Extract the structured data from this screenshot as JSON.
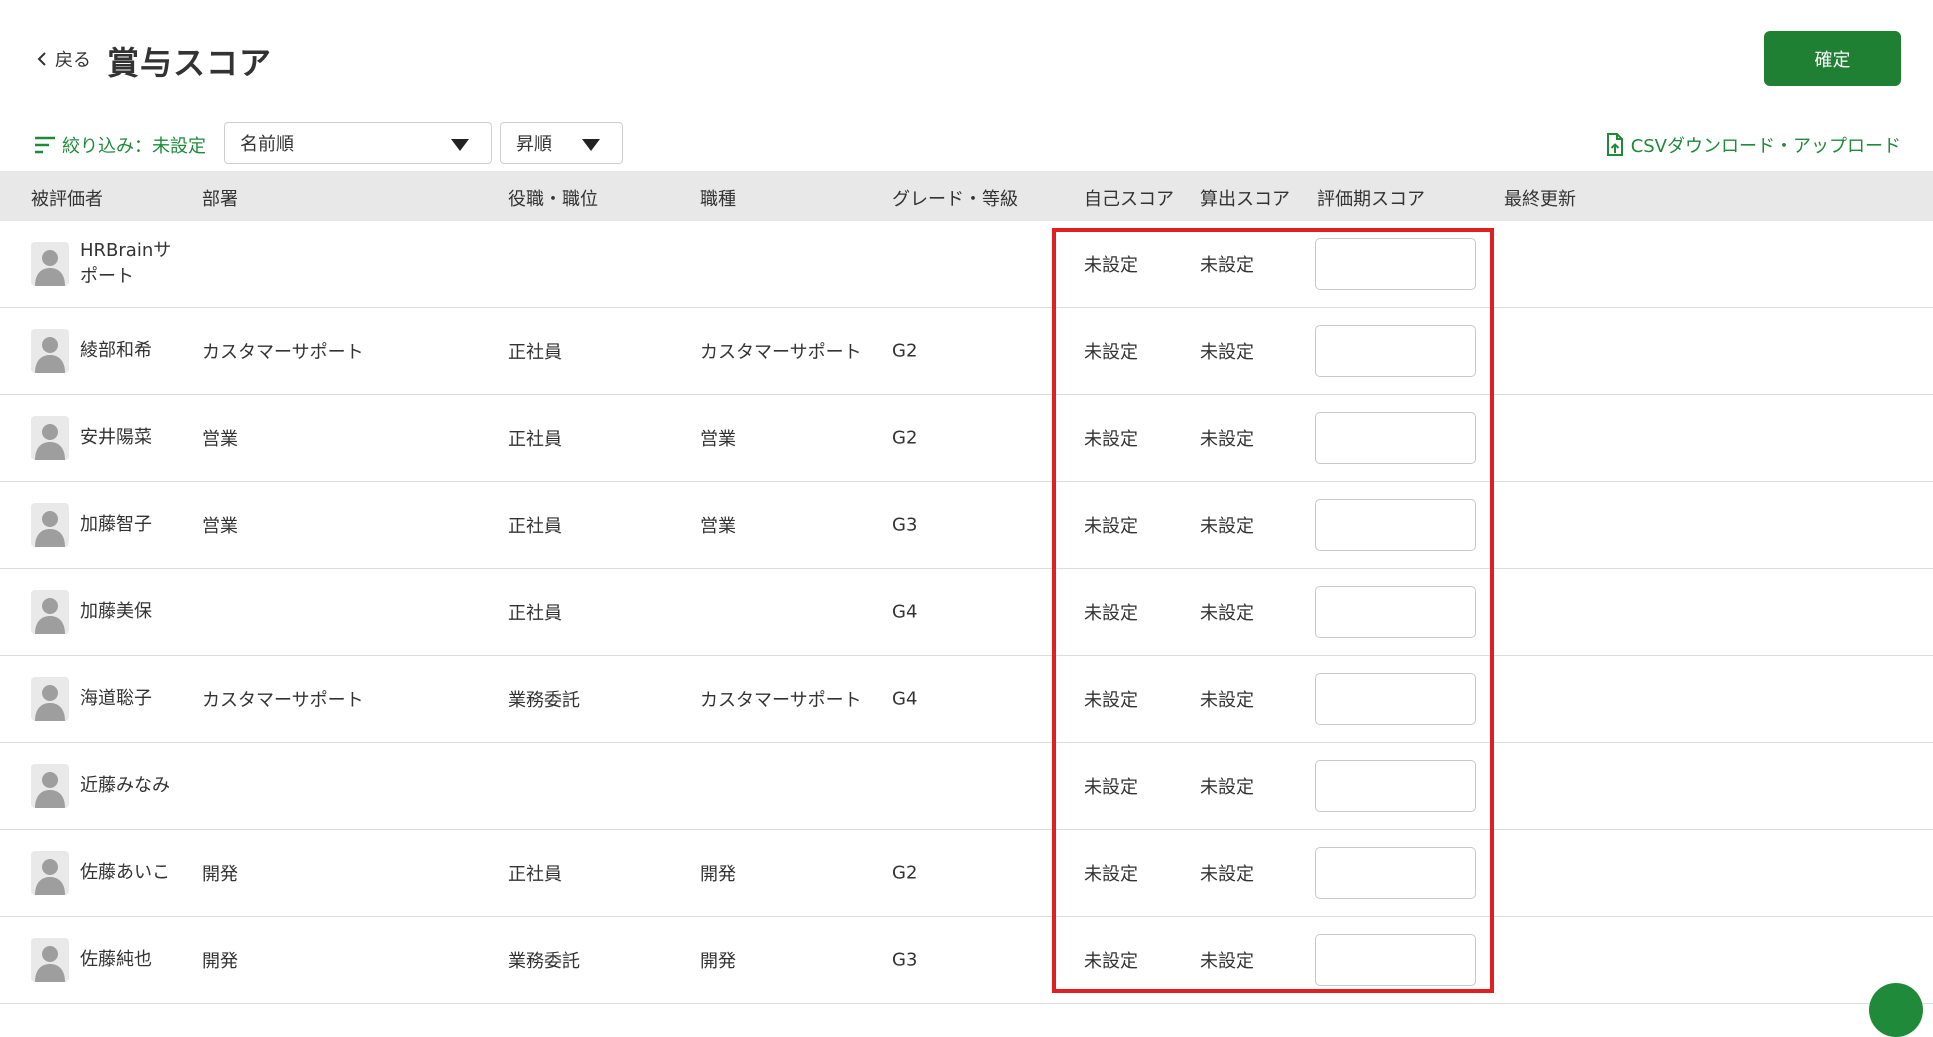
{
  "header": {
    "back_label": "戻る",
    "title": "賞与スコア",
    "confirm_label": "確定"
  },
  "toolbar": {
    "filter_label": "絞り込み：未設定",
    "sort_select": "名前順",
    "order_select": "昇順",
    "csv_label": "CSVダウンロード・アップロード"
  },
  "table": {
    "columns": [
      "被評価者",
      "部署",
      "役職・職位",
      "職種",
      "グレード・等級",
      "自己スコア",
      "算出スコア",
      "評価期スコア",
      "最終更新"
    ],
    "rows": [
      {
        "name": "HRBrainサポート",
        "dept": "",
        "position": "",
        "job": "",
        "grade": "",
        "self_score": "未設定",
        "calc_score": "未設定",
        "period_score": "",
        "updated": ""
      },
      {
        "name": "綾部和希",
        "dept": "カスタマーサポート",
        "position": "正社員",
        "job": "カスタマーサポート",
        "grade": "G2",
        "self_score": "未設定",
        "calc_score": "未設定",
        "period_score": "",
        "updated": ""
      },
      {
        "name": "安井陽菜",
        "dept": "営業",
        "position": "正社員",
        "job": "営業",
        "grade": "G2",
        "self_score": "未設定",
        "calc_score": "未設定",
        "period_score": "",
        "updated": ""
      },
      {
        "name": "加藤智子",
        "dept": "営業",
        "position": "正社員",
        "job": "営業",
        "grade": "G3",
        "self_score": "未設定",
        "calc_score": "未設定",
        "period_score": "",
        "updated": ""
      },
      {
        "name": "加藤美保",
        "dept": "",
        "position": "正社員",
        "job": "",
        "grade": "G4",
        "self_score": "未設定",
        "calc_score": "未設定",
        "period_score": "",
        "updated": ""
      },
      {
        "name": "海道聡子",
        "dept": "カスタマーサポート",
        "position": "業務委託",
        "job": "カスタマーサポート",
        "grade": "G4",
        "self_score": "未設定",
        "calc_score": "未設定",
        "period_score": "",
        "updated": ""
      },
      {
        "name": "近藤みなみ",
        "dept": "",
        "position": "",
        "job": "",
        "grade": "",
        "self_score": "未設定",
        "calc_score": "未設定",
        "period_score": "",
        "updated": ""
      },
      {
        "name": "佐藤あいこ",
        "dept": "開発",
        "position": "正社員",
        "job": "開発",
        "grade": "G2",
        "self_score": "未設定",
        "calc_score": "未設定",
        "period_score": "",
        "updated": ""
      },
      {
        "name": "佐藤純也",
        "dept": "開発",
        "position": "業務委託",
        "job": "開発",
        "grade": "G3",
        "self_score": "未設定",
        "calc_score": "未設定",
        "period_score": "",
        "updated": ""
      }
    ]
  },
  "colors": {
    "brand": "#1f7f32",
    "highlight": "#e02020",
    "header_bg": "#e8e8e8"
  }
}
